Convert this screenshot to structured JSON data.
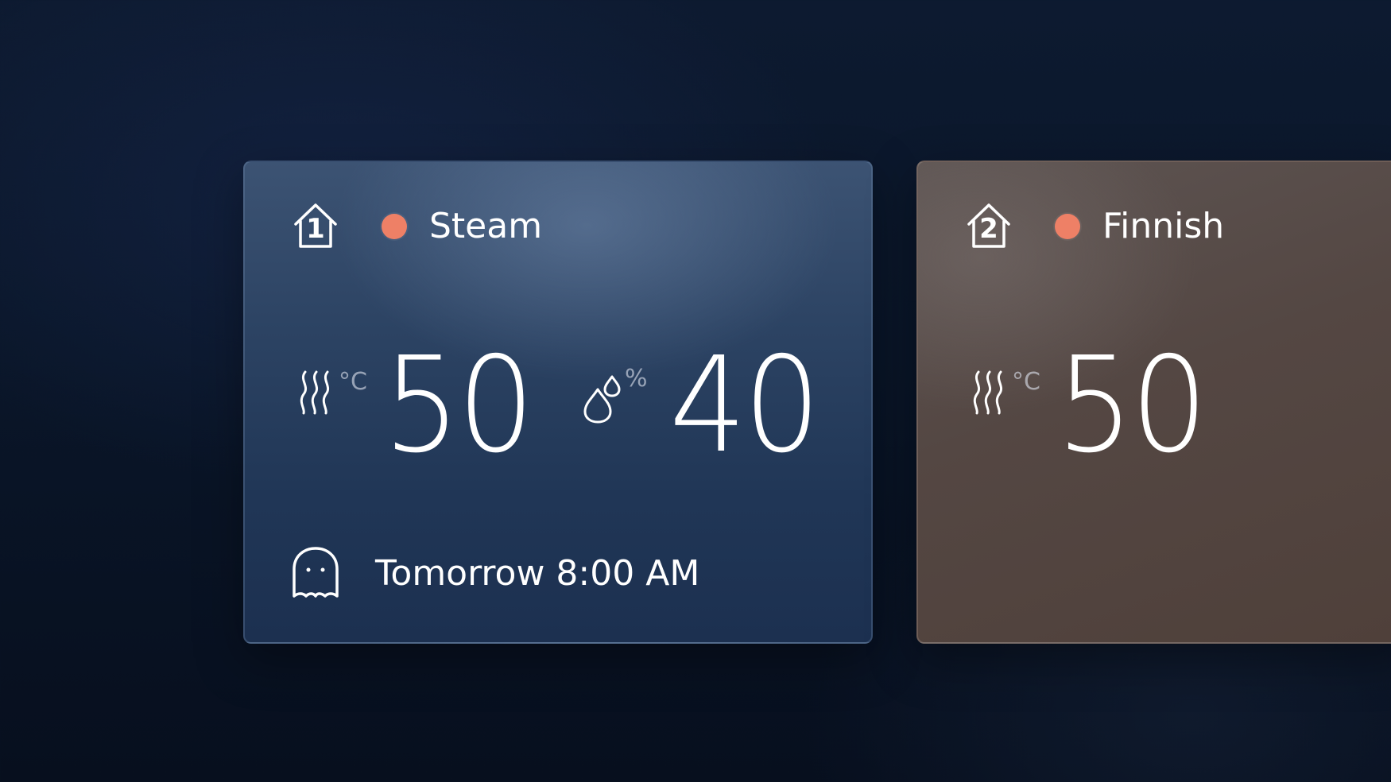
{
  "cards": [
    {
      "room_number": "1",
      "mode": "Steam",
      "status_color": "#ee8066",
      "temperature": {
        "value": "50",
        "unit": "°C"
      },
      "humidity": {
        "value": "40",
        "unit": "%"
      },
      "schedule": "Tomorrow 8:00 AM",
      "background": "blue"
    },
    {
      "room_number": "2",
      "mode": "Finnish",
      "status_color": "#ee8066",
      "temperature": {
        "value": "50",
        "unit": "°C"
      },
      "background": "brown"
    }
  ],
  "icons": {
    "room": "house-icon",
    "temperature": "heat-waves-icon",
    "humidity": "droplet-icon",
    "schedule": "ghost-icon"
  }
}
